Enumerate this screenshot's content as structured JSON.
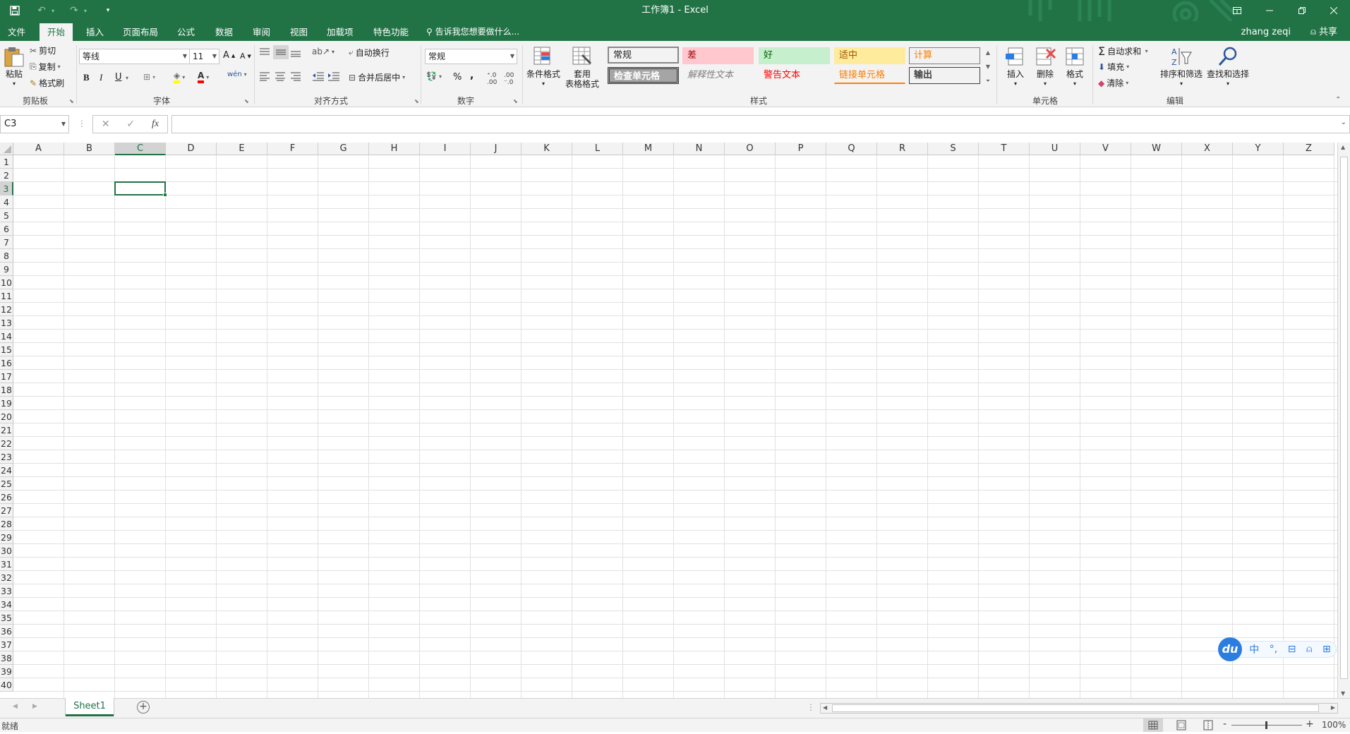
{
  "window": {
    "title": "工作簿1 - Excel"
  },
  "tabs": [
    "文件",
    "开始",
    "插入",
    "页面布局",
    "公式",
    "数据",
    "审阅",
    "视图",
    "加载项",
    "特色功能"
  ],
  "tell_me": "告诉我您想要做什么...",
  "user": {
    "name": "zhang zeqi",
    "share": "共享"
  },
  "clipboard": {
    "paste": "粘贴",
    "cut": "剪切",
    "copy": "复制",
    "format_painter": "格式刷",
    "group": "剪贴板"
  },
  "font": {
    "name": "等线",
    "size": "11",
    "bold": "B",
    "italic": "I",
    "underline": "U",
    "grow": "A",
    "shrink": "A",
    "font_color": "A",
    "wen": "wén",
    "group": "字体"
  },
  "alignment": {
    "wrap": "自动换行",
    "merge": "合并后居中",
    "group": "对齐方式"
  },
  "number": {
    "format": "常规",
    "percent": "%",
    "comma": ",",
    "group": "数字"
  },
  "styles": {
    "conditional": "条件格式",
    "table_line1": "套用",
    "table_line2": "表格格式",
    "cells": [
      {
        "label": "常规",
        "color": "#000000",
        "bg": "#ffffff"
      },
      {
        "label": "差",
        "color": "#9c0006",
        "bg": "#ffc7ce"
      },
      {
        "label": "好",
        "color": "#006100",
        "bg": "#c6efce"
      },
      {
        "label": "适中",
        "color": "#9c5700",
        "bg": "#ffeb9c"
      },
      {
        "label": "计算",
        "color": "#fa7d00",
        "bg": "#f2f2f2"
      },
      {
        "label": "检查单元格",
        "color": "#ffffff",
        "bg": "#a5a5a5"
      },
      {
        "label": "解释性文本",
        "color": "#7f7f7f",
        "bg": "#ffffff"
      },
      {
        "label": "警告文本",
        "color": "#ff0000",
        "bg": "#ffffff"
      },
      {
        "label": "链接单元格",
        "color": "#fa7d00",
        "bg": "#ffffff"
      },
      {
        "label": "输出",
        "color": "#3f3f3f",
        "bg": "#f2f2f2"
      }
    ],
    "group": "样式"
  },
  "cells_group": {
    "insert": "插入",
    "delete": "删除",
    "format": "格式",
    "group": "单元格"
  },
  "editing": {
    "autosum": "自动求和",
    "fill": "填充",
    "clear": "清除",
    "sort": "排序和筛选",
    "find": "查找和选择",
    "group": "编辑"
  },
  "formula_bar": {
    "name_box": "C3",
    "cancel": "✕",
    "enter": "✓",
    "fx": "fx",
    "value": ""
  },
  "grid": {
    "columns": [
      "A",
      "B",
      "C",
      "D",
      "E",
      "F",
      "G",
      "H",
      "I",
      "J",
      "K",
      "L",
      "M",
      "N",
      "O",
      "P",
      "Q",
      "R",
      "S",
      "T",
      "U",
      "V",
      "W",
      "X",
      "Y",
      "Z"
    ],
    "rows": [
      "1",
      "2",
      "3",
      "4",
      "5",
      "6",
      "7",
      "8",
      "9",
      "10",
      "11",
      "12",
      "13",
      "14",
      "15",
      "16",
      "17",
      "18",
      "19",
      "20",
      "21",
      "22",
      "23",
      "24",
      "25",
      "26",
      "27",
      "28",
      "29",
      "30",
      "31",
      "32",
      "33",
      "34",
      "35",
      "36",
      "37",
      "38",
      "39",
      "40"
    ],
    "selected_column": "C",
    "selected_row": "3"
  },
  "sheets": {
    "tabs": [
      "Sheet1"
    ],
    "add": "+"
  },
  "status": {
    "ready": "就绪",
    "zoom": "100%",
    "zoom_minus": "-",
    "zoom_plus": "+"
  },
  "ime": {
    "badge": "du",
    "lang": "中",
    "punct": "°,",
    "box": "⊟",
    "user": "⍝",
    "grid": "⊞"
  },
  "colors": {
    "accent": "#217346",
    "ribbon_bg": "#f3f3f3"
  }
}
